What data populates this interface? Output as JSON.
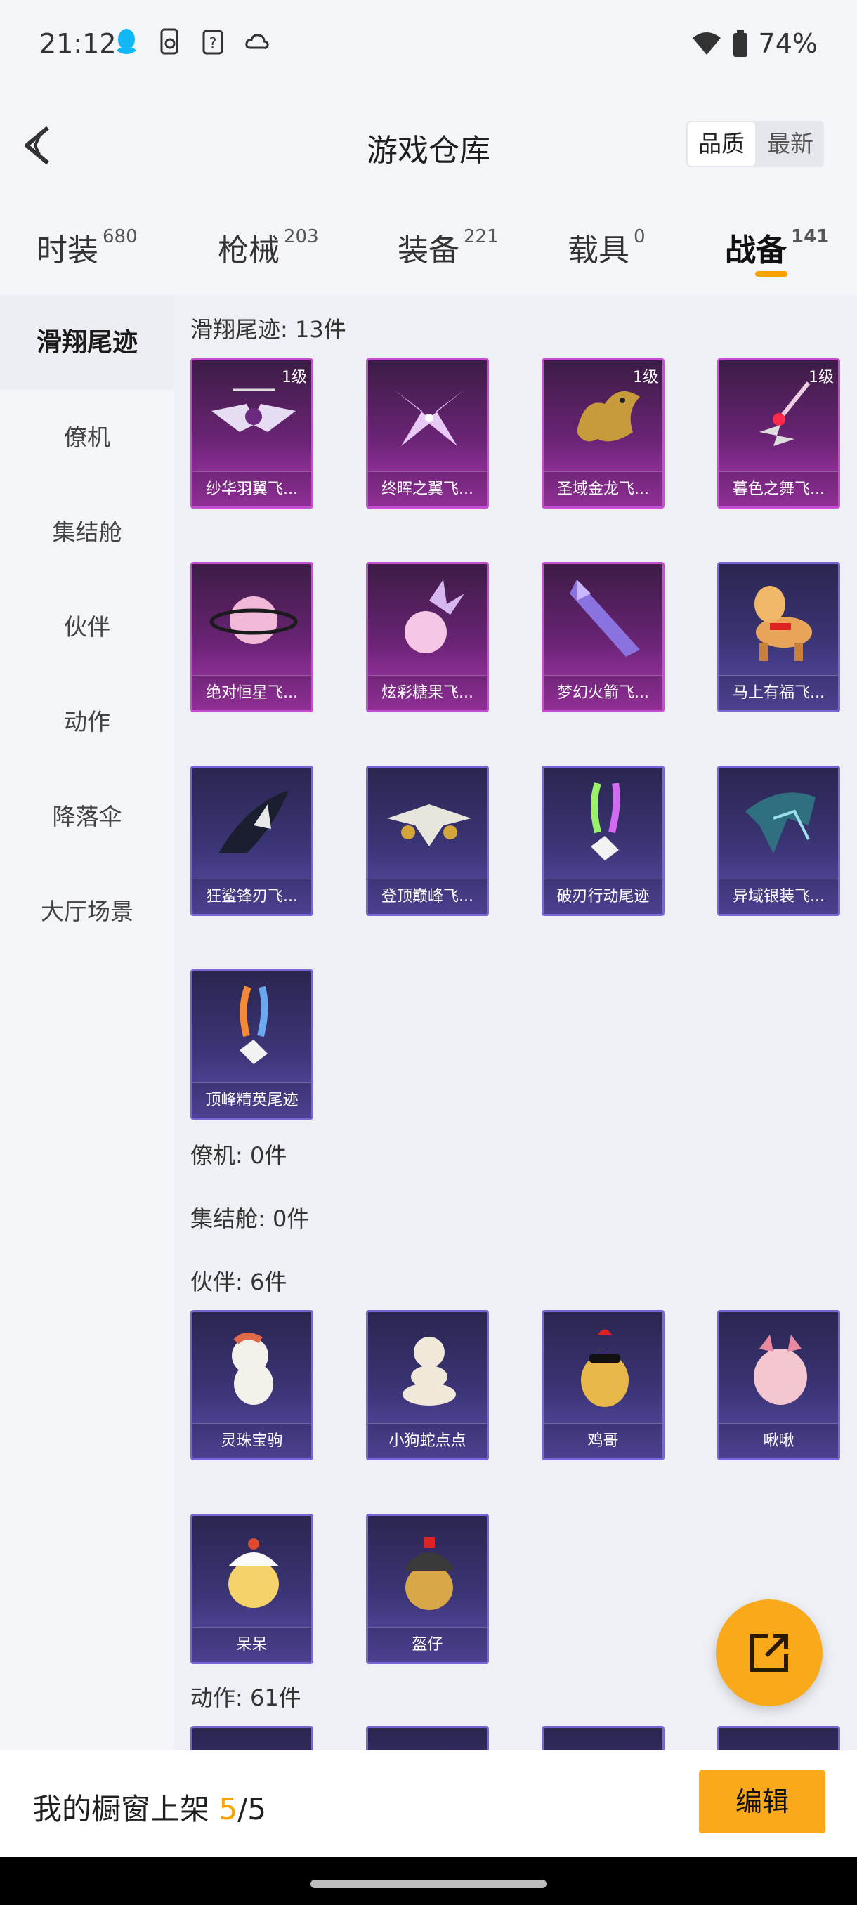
{
  "status": {
    "time": "21:12",
    "battery": "74%"
  },
  "header": {
    "title": "游戏仓库",
    "sort_quality": "品质",
    "sort_latest": "最新"
  },
  "tabs": [
    {
      "label": "时装",
      "count": "680"
    },
    {
      "label": "枪械",
      "count": "203"
    },
    {
      "label": "装备",
      "count": "221"
    },
    {
      "label": "载具",
      "count": "0"
    },
    {
      "label": "战备",
      "count": "141"
    }
  ],
  "sidebar": [
    "滑翔尾迹",
    "僚机",
    "集结舱",
    "伙伴",
    "动作",
    "降落伞",
    "大厅场景"
  ],
  "sections": {
    "glide": {
      "title": "滑翔尾迹: 13件",
      "items": [
        {
          "name": "纱华羽翼飞...",
          "level": "1级"
        },
        {
          "name": "终晖之翼飞..."
        },
        {
          "name": "圣域金龙飞...",
          "level": "1级"
        },
        {
          "name": "暮色之舞飞...",
          "level": "1级"
        },
        {
          "name": "绝对恒星飞..."
        },
        {
          "name": "炫彩糖果飞..."
        },
        {
          "name": "梦幻火箭飞..."
        },
        {
          "name": "马上有福飞..."
        },
        {
          "name": "狂鲨锋刃飞..."
        },
        {
          "name": "登顶巅峰飞..."
        },
        {
          "name": "破刃行动尾迹"
        },
        {
          "name": "异域银装飞..."
        },
        {
          "name": "顶峰精英尾迹"
        }
      ]
    },
    "wingman": {
      "title": "僚机: 0件"
    },
    "pod": {
      "title": "集结舱: 0件"
    },
    "partner": {
      "title": "伙伴: 6件",
      "items": [
        {
          "name": "灵珠宝驹"
        },
        {
          "name": "小狗蛇点点"
        },
        {
          "name": "鸡哥"
        },
        {
          "name": "啾啾"
        },
        {
          "name": "呆呆"
        },
        {
          "name": "盔仔"
        }
      ]
    },
    "emote": {
      "title": "动作: 61件"
    }
  },
  "bottom": {
    "label": "我的橱窗上架",
    "current": "5",
    "total": "/5",
    "edit": "编辑"
  }
}
